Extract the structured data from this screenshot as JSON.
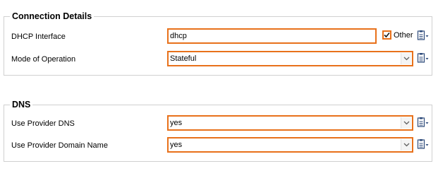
{
  "connection": {
    "title": "Connection Details",
    "dhcp_interface": {
      "label": "DHCP Interface",
      "value": "dhcp",
      "other_label": "Other",
      "other_checked": true
    },
    "mode": {
      "label": "Mode of Operation",
      "value": "Stateful"
    }
  },
  "dns": {
    "title": "DNS",
    "use_provider_dns": {
      "label": "Use Provider DNS",
      "value": "yes"
    },
    "use_provider_domain": {
      "label": "Use Provider Domain Name",
      "value": "yes"
    }
  },
  "colors": {
    "accent": "#e8711b",
    "group_border": "#d0d0d0",
    "icon": "#2c4a7a"
  },
  "icons": [
    "checkbox-check-icon",
    "chevron-down-icon",
    "clipboard-menu-icon"
  ]
}
